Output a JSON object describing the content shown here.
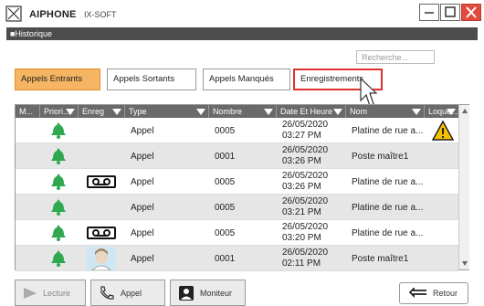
{
  "app": {
    "brand": "AIPHONE",
    "product": "IX-SOFT"
  },
  "section": {
    "title": "■Historique"
  },
  "search": {
    "placeholder": "Recherche..."
  },
  "tabs": [
    {
      "label": "Appels Entrants",
      "state": "active"
    },
    {
      "label": "Appels Sortants",
      "state": "normal"
    },
    {
      "label": "Appels Manqués",
      "state": "normal"
    },
    {
      "label": "Enregistrements",
      "state": "hover"
    }
  ],
  "table": {
    "columns": [
      "M...",
      "Priori...",
      "Enreg",
      "Type",
      "Nombre",
      "Date Et Heure",
      "Nom",
      "Loque..."
    ],
    "rows": [
      {
        "priority_icon": "bell-icon",
        "rec_icon": "",
        "type": "Appel",
        "number": "0005",
        "date": "26/05/2020",
        "time": "03:27 PM",
        "name": "Platine de rue a...",
        "lock_icon": "warning-icon"
      },
      {
        "priority_icon": "bell-icon",
        "rec_icon": "",
        "type": "Appel",
        "number": "0001",
        "date": "26/05/2020",
        "time": "03:26 PM",
        "name": "Poste maître1",
        "lock_icon": ""
      },
      {
        "priority_icon": "bell-icon",
        "rec_icon": "cassette-icon",
        "type": "Appel",
        "number": "0005",
        "date": "26/05/2020",
        "time": "03:26 PM",
        "name": "Platine de rue a...",
        "lock_icon": ""
      },
      {
        "priority_icon": "bell-icon",
        "rec_icon": "",
        "type": "Appel",
        "number": "0005",
        "date": "26/05/2020",
        "time": "03:21 PM",
        "name": "Platine de rue a...",
        "lock_icon": ""
      },
      {
        "priority_icon": "bell-icon",
        "rec_icon": "cassette-icon",
        "type": "Appel",
        "number": "0005",
        "date": "26/05/2020",
        "time": "03:20 PM",
        "name": "Platine de rue a...",
        "lock_icon": ""
      },
      {
        "priority_icon": "bell-icon",
        "rec_icon": "person-icon",
        "type": "Appel",
        "number": "0001",
        "date": "26/05/2020",
        "time": "02:11 PM",
        "name": "Poste maître1",
        "lock_icon": ""
      }
    ]
  },
  "buttons": {
    "lecture": "Lecture",
    "appel": "Appel",
    "moniteur": "Moniteur",
    "retour": "Retour"
  },
  "colors": {
    "active_tab": "#f5b562",
    "header": "#6a6a6a",
    "bell": "#2fa84f",
    "close": "#e04b3d",
    "highlight": "#e03030"
  }
}
